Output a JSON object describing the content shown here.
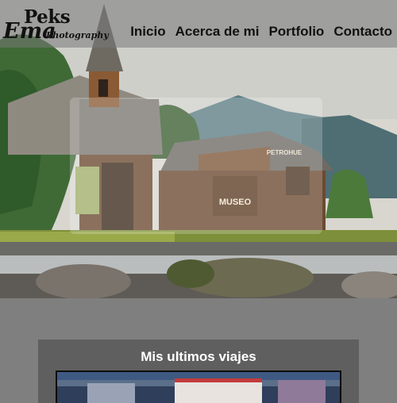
{
  "logo": {
    "line1": "Peks",
    "line2": "Ema",
    "line3": "Photography"
  },
  "nav": {
    "items": [
      {
        "label": "Inicio"
      },
      {
        "label": "Acerca de mi"
      },
      {
        "label": "Portfolio"
      },
      {
        "label": "Contacto"
      }
    ]
  },
  "hero": {
    "sign_museo": "MUSEO",
    "sign_petrohue": "PETROHUE"
  },
  "section": {
    "title": "Mis ultimos viajes"
  },
  "colors": {
    "page_background": "#7f7f7f",
    "card_background": "#5f5f5f",
    "nav_text": "#111111",
    "title_text": "#ffffff"
  }
}
